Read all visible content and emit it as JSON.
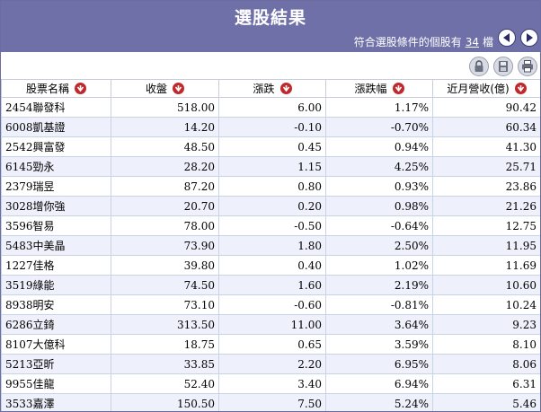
{
  "header": {
    "title": "選股結果",
    "count_prefix": "符合選股條件的個股有",
    "count": "34",
    "count_suffix": "檔"
  },
  "nav": {
    "prev_icon": "prev-page-icon",
    "next_icon": "next-page-icon"
  },
  "toolbar": {
    "icons": [
      "lock-icon",
      "save-icon",
      "print-icon"
    ]
  },
  "columns": [
    "股票名稱",
    "收盤",
    "漲跌",
    "漲跌幅",
    "近月營收(億)"
  ],
  "colors": {
    "header_bg": "#7070a8",
    "up": "#d00000",
    "down": "#007a00",
    "alt_row": "#eef1fb",
    "sort_icon": "#c0282c"
  },
  "rows": [
    {
      "name": "2454聯發科",
      "close": "518.00",
      "change": "6.00",
      "pct": "1.17%",
      "rev": "90.42",
      "dir": "up"
    },
    {
      "name": "6008凱基證",
      "close": "14.20",
      "change": "-0.10",
      "pct": "-0.70%",
      "rev": "60.34",
      "dir": "down"
    },
    {
      "name": "2542興富發",
      "close": "48.50",
      "change": "0.45",
      "pct": "0.94%",
      "rev": "41.30",
      "dir": "up"
    },
    {
      "name": "6145勁永",
      "close": "28.20",
      "change": "1.15",
      "pct": "4.25%",
      "rev": "25.71",
      "dir": "up"
    },
    {
      "name": "2379瑞昱",
      "close": "87.20",
      "change": "0.80",
      "pct": "0.93%",
      "rev": "23.86",
      "dir": "up"
    },
    {
      "name": "3028增你強",
      "close": "20.70",
      "change": "0.20",
      "pct": "0.98%",
      "rev": "21.26",
      "dir": "up"
    },
    {
      "name": "3596智易",
      "close": "78.00",
      "change": "-0.50",
      "pct": "-0.64%",
      "rev": "12.75",
      "dir": "down"
    },
    {
      "name": "5483中美晶",
      "close": "73.90",
      "change": "1.80",
      "pct": "2.50%",
      "rev": "11.95",
      "dir": "up"
    },
    {
      "name": "1227佳格",
      "close": "39.80",
      "change": "0.40",
      "pct": "1.02%",
      "rev": "11.69",
      "dir": "up"
    },
    {
      "name": "3519綠能",
      "close": "74.50",
      "change": "1.60",
      "pct": "2.19%",
      "rev": "10.60",
      "dir": "up"
    },
    {
      "name": "8938明安",
      "close": "73.10",
      "change": "-0.60",
      "pct": "-0.81%",
      "rev": "10.24",
      "dir": "down"
    },
    {
      "name": "6286立錡",
      "close": "313.50",
      "change": "11.00",
      "pct": "3.64%",
      "rev": "9.23",
      "dir": "up"
    },
    {
      "name": "8107大億科",
      "close": "18.75",
      "change": "0.65",
      "pct": "3.59%",
      "rev": "8.10",
      "dir": "up"
    },
    {
      "name": "5213亞昕",
      "close": "33.85",
      "change": "2.20",
      "pct": "6.95%",
      "rev": "8.06",
      "dir": "up"
    },
    {
      "name": "9955佳龍",
      "close": "52.40",
      "change": "3.40",
      "pct": "6.94%",
      "rev": "6.31",
      "dir": "up"
    },
    {
      "name": "3533嘉澤",
      "close": "150.50",
      "change": "7.50",
      "pct": "5.24%",
      "rev": "5.46",
      "dir": "up"
    }
  ]
}
